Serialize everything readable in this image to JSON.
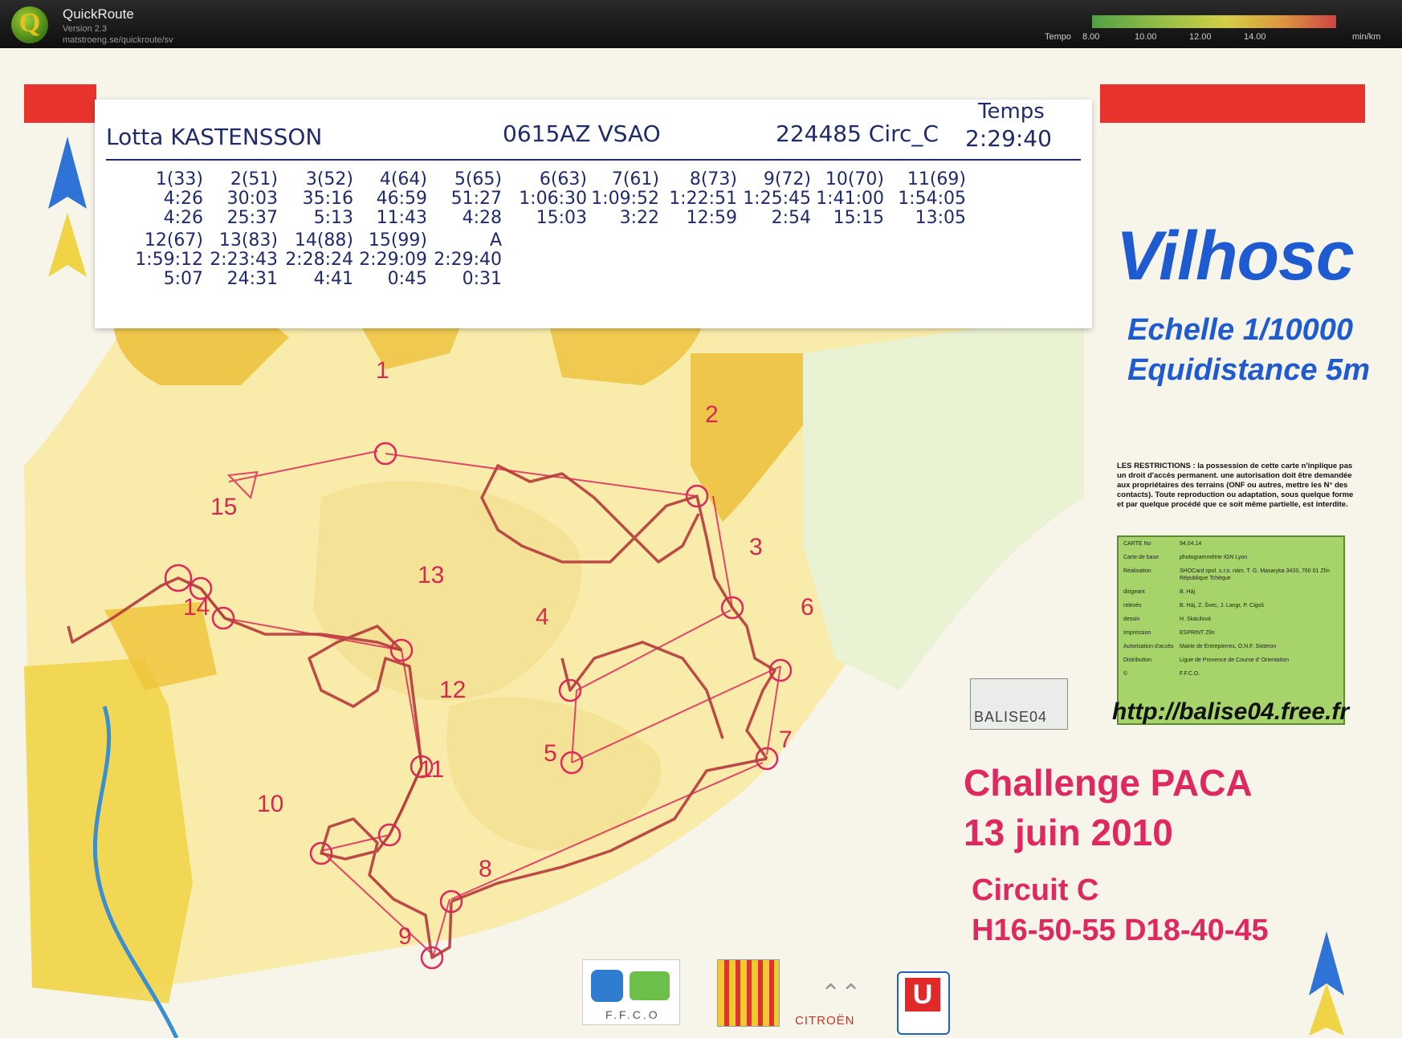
{
  "app": {
    "name": "QuickRoute",
    "version": "Version 2.3",
    "url": "matstroeng.se/quickroute/sv"
  },
  "tempo": {
    "label": "Tempo",
    "ticks": [
      "8.00",
      "10.00",
      "12.00",
      "14.00"
    ],
    "unit": "min/km"
  },
  "header": {
    "runner": "Lotta KASTENSSON",
    "club": "0615AZ VSAO",
    "course": "224485 Circ_C",
    "time_label": "Temps",
    "time": "2:29:40"
  },
  "splits": {
    "row1": [
      {
        "control": "1(33)",
        "cumulative": "4:26",
        "leg": "4:26"
      },
      {
        "control": "2(51)",
        "cumulative": "30:03",
        "leg": "25:37"
      },
      {
        "control": "3(52)",
        "cumulative": "35:16",
        "leg": "5:13"
      },
      {
        "control": "4(64)",
        "cumulative": "46:59",
        "leg": "11:43"
      },
      {
        "control": "5(65)",
        "cumulative": "51:27",
        "leg": "4:28"
      },
      {
        "control": "6(63)",
        "cumulative": "1:06:30",
        "leg": "15:03"
      },
      {
        "control": "7(61)",
        "cumulative": "1:09:52",
        "leg": "3:22"
      },
      {
        "control": "8(73)",
        "cumulative": "1:22:51",
        "leg": "12:59"
      },
      {
        "control": "9(72)",
        "cumulative": "1:25:45",
        "leg": "2:54"
      },
      {
        "control": "10(70)",
        "cumulative": "1:41:00",
        "leg": "15:15"
      },
      {
        "control": "11(69)",
        "cumulative": "1:54:05",
        "leg": "13:05"
      }
    ],
    "row2": [
      {
        "control": "12(67)",
        "cumulative": "1:59:12",
        "leg": "5:07"
      },
      {
        "control": "13(83)",
        "cumulative": "2:23:43",
        "leg": "24:31"
      },
      {
        "control": "14(88)",
        "cumulative": "2:28:24",
        "leg": "4:41"
      },
      {
        "control": "15(99)",
        "cumulative": "2:29:09",
        "leg": "0:45"
      },
      {
        "control": "A",
        "cumulative": "2:29:40",
        "leg": "0:31"
      }
    ]
  },
  "map": {
    "title": "Vilhosc",
    "scale": "Echelle 1/10000",
    "equidistance": "Equidistance 5m",
    "restrictions": "LES RESTRICTIONS : la possession de cette carte n'inplique pas un droit d'accès permanent. une autorisation doit être demandée aux propriétaires des terrains (ONF ou autres, mettre les N° des contacts). Toute reproduction ou adaptation, sous quelque forme et par quelque procédé que ce soit même partielle, est interdite.",
    "website": "http://balise04.free.fr",
    "event": "Challenge PACA",
    "date": "13 juin 2010",
    "circuit": "Circuit C",
    "categories": "H16-50-55 D18-40-45",
    "balise_logo": "BALISE04",
    "sponsors": [
      "F.F.C.O",
      "CITROËN"
    ],
    "controls": [
      "1",
      "2",
      "3",
      "4",
      "5",
      "6",
      "7",
      "8",
      "9",
      "10",
      "11",
      "12",
      "13",
      "14",
      "15"
    ],
    "credits": [
      {
        "label": "CARTE No",
        "value": "94.04.14"
      },
      {
        "label": "Carte de base",
        "value": "photogrammétrie IGN Lyon"
      },
      {
        "label": "Réalisation",
        "value": "SHOCard spol. s.r.o. nám. T. G. Masaryka 3433, 760 01 Zlín République Tchèque"
      },
      {
        "label": "dirigeant",
        "value": "B. Háj"
      },
      {
        "label": "relevés",
        "value": "B. Háj, Z. Švec, J. Langr, P. Cigoš"
      },
      {
        "label": "dessin",
        "value": "H. Skácilová"
      },
      {
        "label": "Impression",
        "value": "ESPRINT Zlín"
      },
      {
        "label": "Autorisation d'accès",
        "value": "Mairie de Entrepierres, O.N.F. Sisteron"
      },
      {
        "label": "Distribution",
        "value": "Ligue de Provence de Course d' Orientation"
      },
      {
        "label": "©",
        "value": "F.F.C.O."
      }
    ]
  }
}
